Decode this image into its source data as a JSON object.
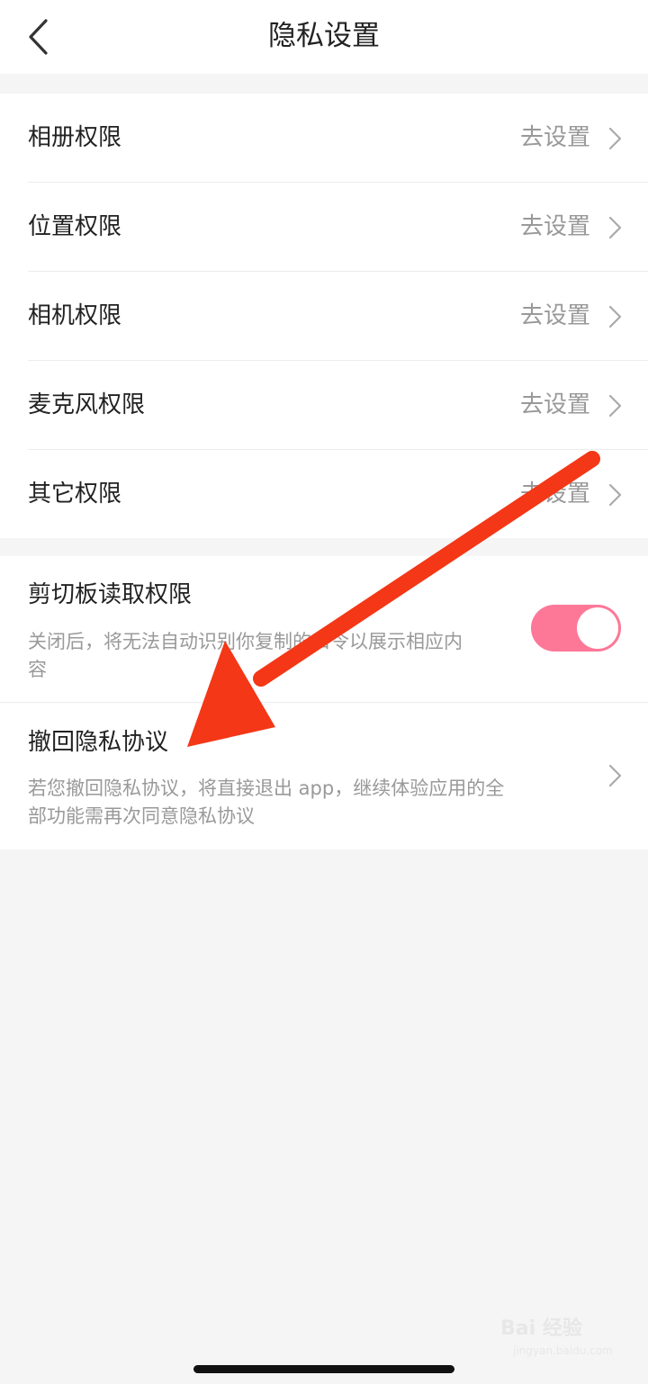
{
  "header": {
    "title": "隐私设置"
  },
  "permissions": [
    {
      "label": "相册权限",
      "action": "去设置"
    },
    {
      "label": "位置权限",
      "action": "去设置"
    },
    {
      "label": "相机权限",
      "action": "去设置"
    },
    {
      "label": "麦克风权限",
      "action": "去设置"
    },
    {
      "label": "其它权限",
      "action": "去设置"
    }
  ],
  "clipboard": {
    "title": "剪切板读取权限",
    "desc_line1": "关闭后，将无法自动识别你复制的口令以展示相应内",
    "desc_line2": "容",
    "enabled": true
  },
  "revoke": {
    "title": "撤回隐私协议",
    "desc_line1": "若您撤回隐私协议，将直接退出 app，继续体验应用的全",
    "desc_line2": "部功能需再次同意隐私协议"
  },
  "watermark": {
    "main": "Bai 经验",
    "sub": "jingyan.baidu.com"
  },
  "colors": {
    "toggle_on": "#fd7897",
    "annotation_arrow": "#f43716"
  }
}
